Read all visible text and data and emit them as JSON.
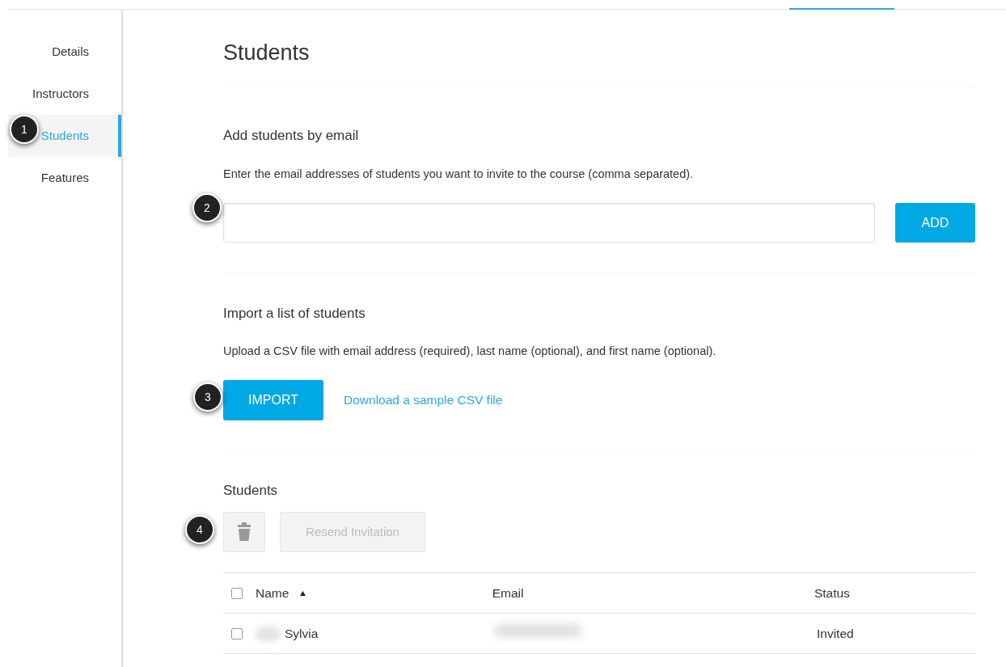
{
  "sidebar": {
    "items": [
      {
        "label": "Details",
        "selected": false
      },
      {
        "label": "Instructors",
        "selected": false
      },
      {
        "label": "Students",
        "selected": true
      },
      {
        "label": "Features",
        "selected": false
      }
    ]
  },
  "page_title": "Students",
  "add_section": {
    "heading": "Add students by email",
    "description": "Enter the email addresses of students you want to invite to the course (comma separated).",
    "button": "ADD"
  },
  "import_section": {
    "heading": "Import a list of students",
    "description": "Upload a CSV file with email address (required), last name (optional), and first name (optional).",
    "button": "IMPORT",
    "link": "Download a sample CSV file"
  },
  "students_section": {
    "heading": "Students",
    "resend_button": "Resend Invitation",
    "table": {
      "columns": [
        {
          "label": "Name",
          "sorted": true
        },
        {
          "label": "Email",
          "sorted": false
        },
        {
          "label": "Status",
          "sorted": false
        }
      ],
      "rows": [
        {
          "checked": false,
          "name": "Sylvia",
          "status": "Invited"
        }
      ]
    }
  },
  "select_all_checked": false,
  "callouts": [
    "1",
    "2",
    "3",
    "4"
  ]
}
